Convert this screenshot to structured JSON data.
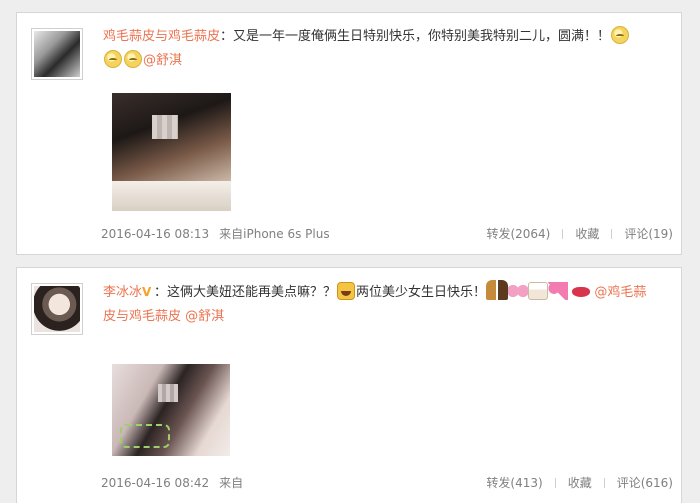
{
  "posts": [
    {
      "author": "鸡毛蒜皮与鸡毛蒜皮",
      "text": "又是一年一度俺俩生日特别快乐，你特别美我特别二儿，圆满！！",
      "mention": "@舒淇",
      "timestamp": "2016-04-16 08:13",
      "source": "来自iPhone 6s Plus",
      "repost": "转发(2064)",
      "favorite": "收藏",
      "comment": "评论(19)"
    },
    {
      "author": "李冰冰",
      "text_a": "这俩大美妞还能再美点嘛？？",
      "text_b": "两位美少女生日快乐！",
      "mention_a": "@鸡毛蒜",
      "mention_b_pre": "皮与鸡毛蒜皮",
      "mention_b": "@舒淇",
      "timestamp": "2016-04-16 08:42",
      "source": "来自",
      "repost": "转发(413)",
      "favorite": "收藏",
      "comment": "评论(616)"
    }
  ],
  "icons": {
    "verified_badge": "V",
    "emoji_sleepy": "sleepy-face-icon",
    "emoji_cry": "crying-face-icon"
  },
  "colors": {
    "name": "#eb7350",
    "meta": "#808080",
    "background": "#eeeeee"
  }
}
